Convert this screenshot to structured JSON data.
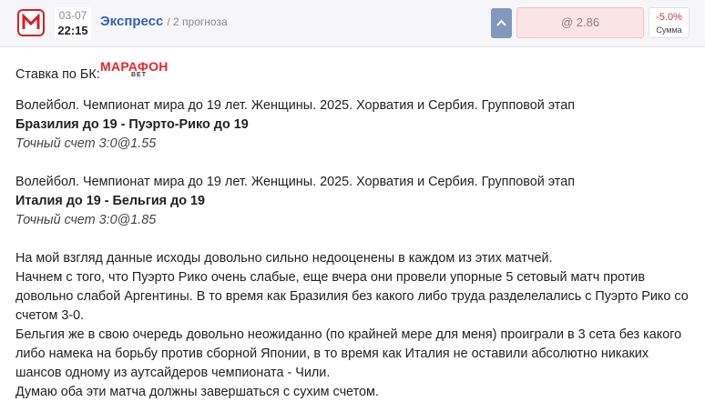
{
  "header": {
    "date": "03-07",
    "time": "22:15",
    "bet_type": "Экспресс",
    "forecasts": "/ 2 прогноза",
    "odds": "@ 2.86",
    "result_value": "-5.0%",
    "result_label": "Сумма",
    "brand_color": "#d42026",
    "link_color": "#2f63b4"
  },
  "bookmaker": {
    "label": "Ставка по БК:",
    "logo_text": "МАРАФОН",
    "logo_sub": "BET"
  },
  "events": [
    {
      "tournament": "Волейбол. Чемпионат мира до 19 лет. Женщины. 2025. Хорватия и Сербия. Групповой этап",
      "match": "Бразилия до 19 - Пуэрто-Рико до 19",
      "pick": "Точный счет 3:0@1.55"
    },
    {
      "tournament": "Волейбол. Чемпионат мира до 19 лет. Женщины. 2025. Хорватия и Сербия. Групповой этап",
      "match": "Италия до 19 - Бельгия до 19",
      "pick": "Точный счет 3:0@1.85"
    }
  ],
  "description": [
    "На мой взгляд данные исходы довольно сильно недооценены в каждом из этих матчей.",
    "Начнем с того, что Пуэрто Рико очень слабые, еще вчера они провели упорные 5 сетовый матч против",
    "довольно слабой Аргентины. В то время как Бразилия без какого либо труда разделелались с Пуэрто Рико со",
    "счетом 3-0.",
    "Бельгия же в свою очередь довольно неожиданно (по крайней мере для меня) проиграли в 3 сета без какого",
    "либо намека на борьбу против сборной Японии, в то время как Италия не оставили абсолютно никаких",
    "шансов одному из аутсайдеров чемпионата - Чили.",
    "Думаю оба эти матча должны завершаться с сухим счетом."
  ]
}
